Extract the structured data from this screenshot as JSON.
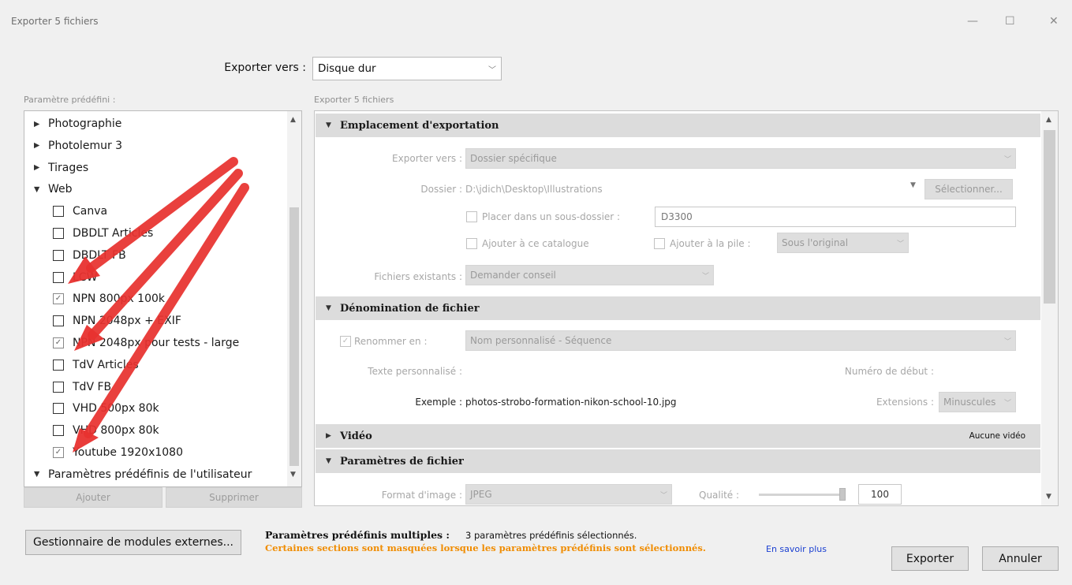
{
  "window": {
    "title": "Exporter 5 fichiers",
    "min": "—",
    "max": "☐",
    "close": "✕"
  },
  "top": {
    "export_to_label": "Exporter vers :",
    "export_to_value": "Disque dur"
  },
  "preset": {
    "label": "Paramètre prédéfini :",
    "items": [
      {
        "type": "folder",
        "label": "Photographie",
        "expanded": false
      },
      {
        "type": "folder",
        "label": "Photolemur 3",
        "expanded": false
      },
      {
        "type": "folder",
        "label": "Tirages",
        "expanded": false
      },
      {
        "type": "folder",
        "label": "Web",
        "expanded": true
      },
      {
        "type": "item",
        "label": "Canva",
        "checked": false
      },
      {
        "type": "item",
        "label": "DBDLT Articles",
        "checked": false
      },
      {
        "type": "item",
        "label": "DBDLT FB",
        "checked": false
      },
      {
        "type": "item",
        "label": "LCW",
        "checked": false
      },
      {
        "type": "item",
        "label": "NPN 800px 100k",
        "checked": true
      },
      {
        "type": "item",
        "label": "NPN 2048px + EXIF",
        "checked": false
      },
      {
        "type": "item",
        "label": "NPN 2048px pour tests - large",
        "checked": true
      },
      {
        "type": "item",
        "label": "TdV Articles",
        "checked": false
      },
      {
        "type": "item",
        "label": "TdV FB",
        "checked": false
      },
      {
        "type": "item",
        "label": "VHD 500px 80k",
        "checked": false
      },
      {
        "type": "item",
        "label": "VHD 800px 80k",
        "checked": false
      },
      {
        "type": "item",
        "label": "Youtube 1920x1080",
        "checked": true
      },
      {
        "type": "folder",
        "label": "Paramètres prédéfinis de l'utilisateur",
        "expanded": true
      }
    ],
    "add_label": "Ajouter",
    "remove_label": "Supprimer"
  },
  "main": {
    "header": "Exporter 5 fichiers",
    "sections": {
      "location": {
        "title": "Emplacement d'exportation",
        "export_to_label": "Exporter vers :",
        "export_to_value": "Dossier spécifique",
        "folder_label": "Dossier :",
        "folder_value": "D:\\jdich\\Desktop\\Illustrations",
        "select_label": "Sélectionner...",
        "subfolder_label": "Placer dans un sous-dossier :",
        "subfolder_value": "D3300",
        "add_catalog_label": "Ajouter à ce catalogue",
        "add_stack_label": "Ajouter à la pile :",
        "stack_value": "Sous l'original",
        "existing_label": "Fichiers existants :",
        "existing_value": "Demander conseil"
      },
      "naming": {
        "title": "Dénomination de fichier",
        "rename_label": "Renommer en :",
        "rename_value": "Nom personnalisé - Séquence",
        "custom_text_label": "Texte personnalisé :",
        "start_number_label": "Numéro de début :",
        "example_label": "Exemple :",
        "example_value": "photos-strobo-formation-nikon-school-10.jpg",
        "extensions_label": "Extensions :",
        "extensions_value": "Minuscules"
      },
      "video": {
        "title": "Vidéo",
        "status": "Aucune vidéo"
      },
      "file_settings": {
        "title": "Paramètres de fichier",
        "format_label": "Format d'image :",
        "format_value": "JPEG",
        "quality_label": "Qualité :",
        "quality_value": "100",
        "quality_fraction": 1.0
      }
    }
  },
  "bottom": {
    "plugin_manager_label": "Gestionnaire de modules externes...",
    "multi_label": "Paramètres prédéfinis multiples :",
    "multi_value": "3 paramètres prédéfinis sélectionnés.",
    "warning": "Certaines sections sont masquées lorsque les paramètres prédéfinis sont sélectionnés.",
    "learn_more": "En savoir plus",
    "export_label": "Exporter",
    "cancel_label": "Annuler"
  },
  "colors": {
    "warning": "#f08c00",
    "link": "#1a3fd1",
    "annotation_arrow": "#e8322f"
  }
}
